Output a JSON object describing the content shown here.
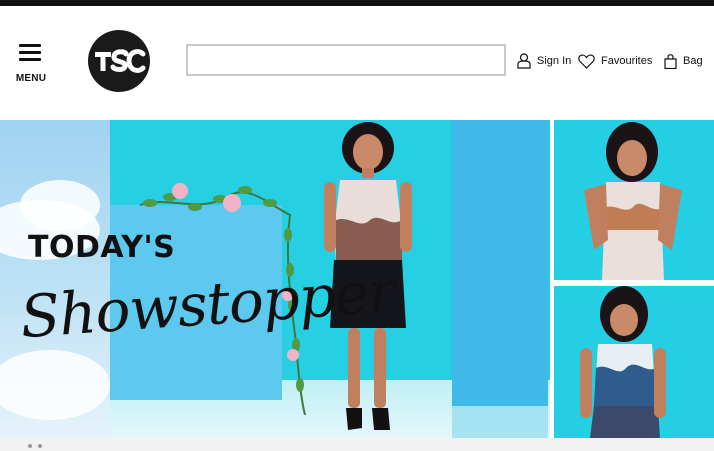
{
  "header": {
    "menu_label": "MENU",
    "logo_text": "TSC",
    "search": {
      "value": "",
      "placeholder": ""
    },
    "sign_in": "Sign In",
    "favourites": "Favourites",
    "bag": "Bag"
  },
  "hero": {
    "line1": "TODAY'S",
    "line2": "Showstopper",
    "trademark": "™"
  },
  "colors": {
    "brand_dark": "#1a1a1a",
    "hero_aqua": "#22cde0",
    "hero_blue": "#41b8ea"
  },
  "icons": [
    "menu-icon",
    "user-icon",
    "heart-icon",
    "bag-icon"
  ]
}
